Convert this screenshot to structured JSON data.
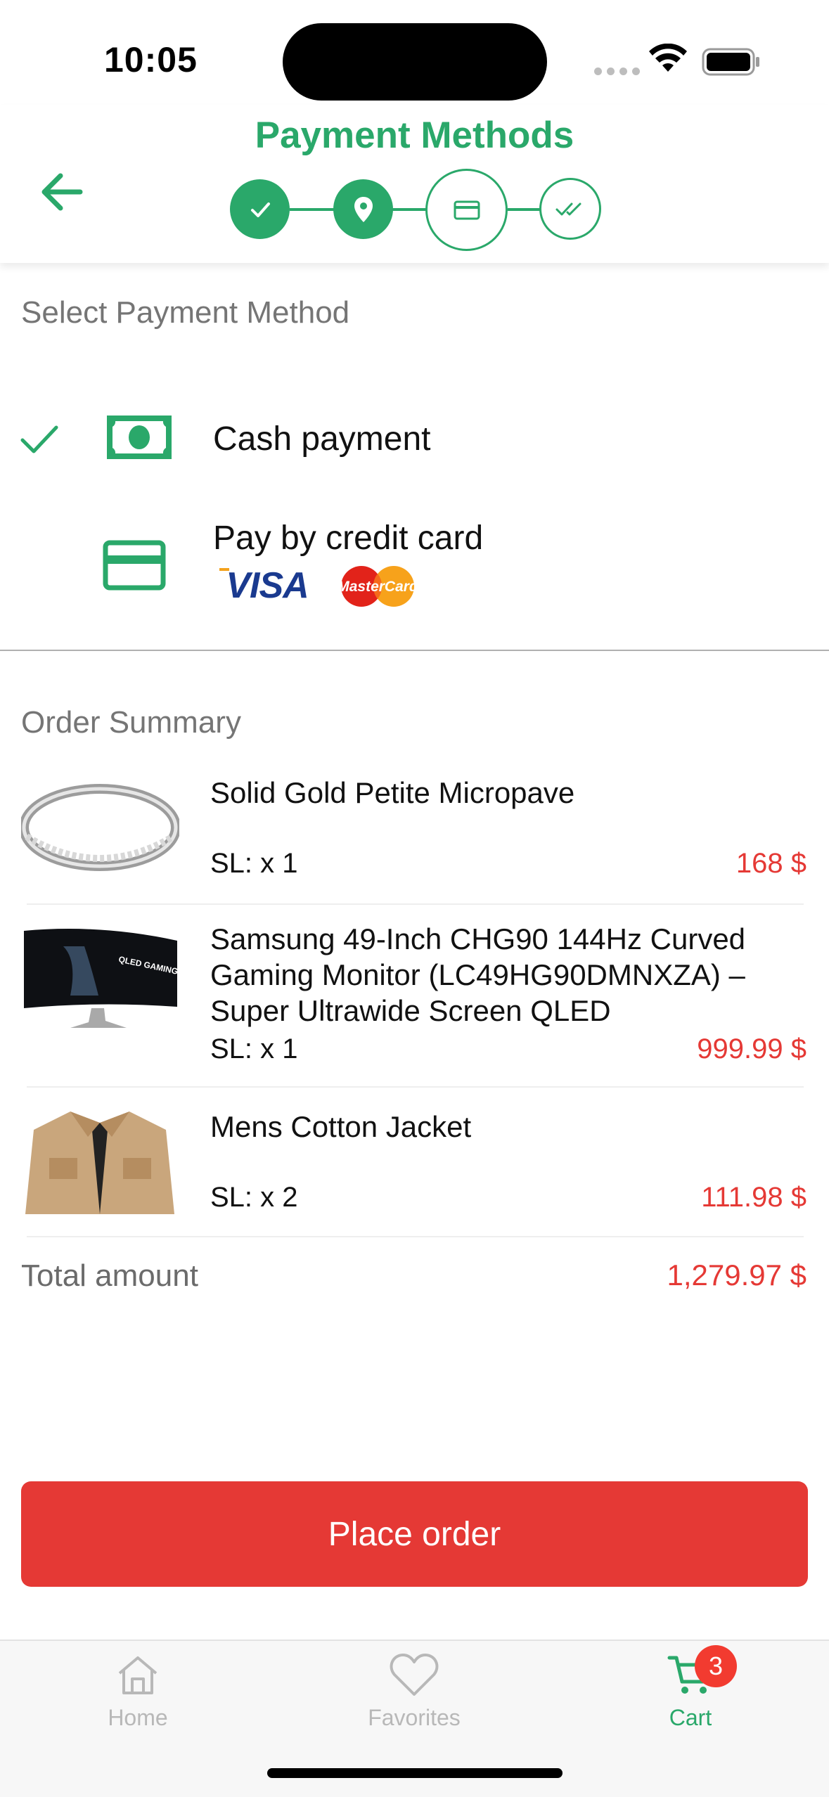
{
  "status_bar": {
    "time": "10:05"
  },
  "header": {
    "title": "Payment Methods",
    "steps": [
      {
        "name": "step-cart-done",
        "icon": "check-icon",
        "state": "done"
      },
      {
        "name": "step-address-done",
        "icon": "location-pin-icon",
        "state": "done"
      },
      {
        "name": "step-payment-current",
        "icon": "credit-card-icon",
        "state": "current"
      },
      {
        "name": "step-confirm",
        "icon": "double-check-icon",
        "state": "todo"
      }
    ]
  },
  "payment": {
    "section_title": "Select Payment Method",
    "options": [
      {
        "label": "Cash payment",
        "icon": "cash-icon",
        "selected": true
      },
      {
        "label": "Pay by credit card",
        "icon": "credit-card-icon",
        "selected": false,
        "brands": [
          "VISA",
          "MasterCard"
        ]
      }
    ]
  },
  "order": {
    "section_title": "Order Summary",
    "items": [
      {
        "name": "Solid Gold Petite Micropave",
        "qty": "SL: x 1",
        "price": "168 $",
        "image": "ring-image"
      },
      {
        "name": "Samsung 49-Inch CHG90 144Hz Curved Gaming Monitor (LC49HG90DMNXZA) – Super Ultrawide Screen QLED",
        "qty": "SL: x 1",
        "price": "999.99 $",
        "image": "monitor-image",
        "image_text": "QLED GAMING MONITOR"
      },
      {
        "name": "Mens Cotton Jacket",
        "qty": "SL: x 2",
        "price": "111.98 $",
        "image": "jacket-image"
      }
    ],
    "total_label": "Total amount",
    "total_value": "1,279.97 $"
  },
  "actions": {
    "place_order": "Place order"
  },
  "tabbar": {
    "tabs": [
      {
        "label": "Home",
        "icon": "home-icon",
        "active": false
      },
      {
        "label": "Favorites",
        "icon": "heart-icon",
        "active": false
      },
      {
        "label": "Cart",
        "icon": "cart-icon",
        "active": true,
        "badge": "3"
      }
    ]
  },
  "colors": {
    "accent": "#2aa86a",
    "danger": "#e53935",
    "badge": "#f23b30"
  }
}
